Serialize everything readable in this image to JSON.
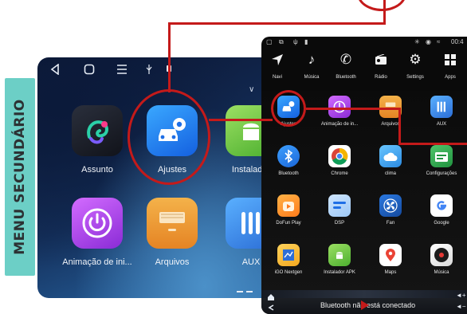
{
  "side_label": "MENU SECUNDÁRIO",
  "left_menu": {
    "apps": [
      {
        "label": "Assunto",
        "icon": "chameleon-icon"
      },
      {
        "label": "Ajustes",
        "icon": "car-settings-icon"
      },
      {
        "label": "Instalador",
        "icon": "android-icon"
      },
      {
        "label": "Animação de ini...",
        "icon": "power-icon"
      },
      {
        "label": "Arquivos",
        "icon": "drawer-icon"
      },
      {
        "label": "AUX",
        "icon": "aux-cable-icon"
      }
    ]
  },
  "right_menu": {
    "status_time": "00:4",
    "dock": [
      {
        "label": "Navi",
        "icon": "navigation-arrow-icon"
      },
      {
        "label": "Música",
        "icon": "music-note-icon"
      },
      {
        "label": "Bluetooth",
        "icon": "phone-icon"
      },
      {
        "label": "Rádio",
        "icon": "radio-icon"
      },
      {
        "label": "Settings",
        "icon": "gear-icon"
      },
      {
        "label": "Apps",
        "icon": "apps-grid-icon"
      }
    ],
    "grid": [
      {
        "label": "Ajustes",
        "icon": "car-settings-icon"
      },
      {
        "label": "Animação de in...",
        "icon": "power-icon"
      },
      {
        "label": "Arquivos",
        "icon": "drawer-icon"
      },
      {
        "label": "AUX",
        "icon": "aux-cable-icon"
      },
      {
        "label": "Bluetooth",
        "icon": "bluetooth-icon"
      },
      {
        "label": "Chrome",
        "icon": "chrome-icon"
      },
      {
        "label": "clima",
        "icon": "weather-icon"
      },
      {
        "label": "Configurações",
        "icon": "settings-grid-icon"
      },
      {
        "label": "DoFun Play",
        "icon": "dofun-play-icon"
      },
      {
        "label": "DSP",
        "icon": "dsp-icon"
      },
      {
        "label": "Fan",
        "icon": "fan-icon"
      },
      {
        "label": "Google",
        "icon": "google-icon"
      },
      {
        "label": "iGO Nextgen",
        "icon": "igo-map-icon"
      },
      {
        "label": "Instalador APK",
        "icon": "android-icon"
      },
      {
        "label": "Maps",
        "icon": "maps-pin-icon"
      },
      {
        "label": "Música",
        "icon": "music-disc-icon"
      }
    ],
    "bottom_bar_text": "Bluetooth não está conectado"
  },
  "colors": {
    "annotation_red": "#c41a1a",
    "side_label_bg": "#6ccfc6"
  }
}
